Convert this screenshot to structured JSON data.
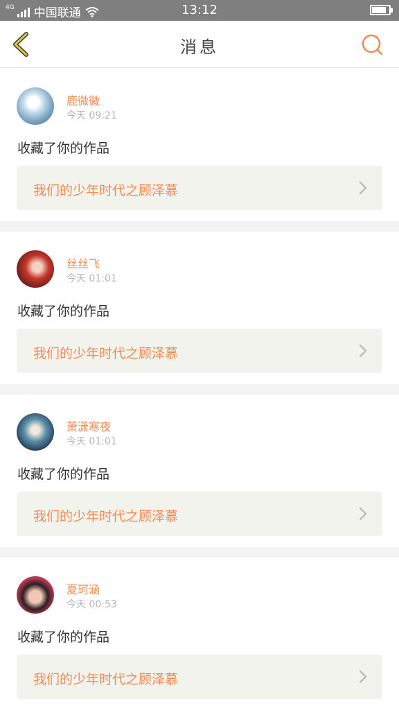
{
  "status_bar": {
    "network_tag": "4G",
    "carrier": "中国联通",
    "time": "13:12",
    "battery_level": 0.85
  },
  "nav": {
    "title": "消息",
    "back_icon": "chevron-left-icon",
    "search_icon": "search-icon",
    "accent_color": "#f08a52"
  },
  "messages": [
    {
      "username": "鹿微微",
      "time": "今天 09:21",
      "action": "收藏了你的作品",
      "work_title": "我们的少年时代之顾泽慕"
    },
    {
      "username": "丝丝飞",
      "time": "今天 01:01",
      "action": "收藏了你的作品",
      "work_title": "我们的少年时代之顾泽慕"
    },
    {
      "username": "萧潇寒夜",
      "time": "今天 01:01",
      "action": "收藏了你的作品",
      "work_title": "我们的少年时代之顾泽慕"
    },
    {
      "username": "夏珂涵",
      "time": "今天 00:53",
      "action": "收藏了你的作品",
      "work_title": "我们的少年时代之顾泽慕"
    }
  ]
}
